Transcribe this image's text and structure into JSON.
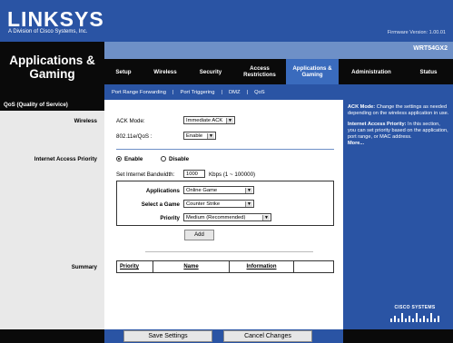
{
  "brand": {
    "logo": "LINKSYS",
    "tagline": "A Division of Cisco Systems, Inc.",
    "firmware": "Firmware Version: 1.00.01",
    "model": "WRT54GX2"
  },
  "section_title": "Applications & Gaming",
  "tabs": [
    {
      "label": "Setup",
      "active": false
    },
    {
      "label": "Wireless",
      "active": false
    },
    {
      "label": "Security",
      "active": false
    },
    {
      "label": "Access Restrictions",
      "active": false
    },
    {
      "label": "Applications & Gaming",
      "active": true
    },
    {
      "label": "Administration",
      "active": false
    },
    {
      "label": "Status",
      "active": false
    }
  ],
  "subtabs": [
    "Port Range Forwarding",
    "Port Triggering",
    "DMZ",
    "QoS"
  ],
  "left": {
    "header": "QoS (Quality of Service)",
    "wireless": "Wireless",
    "internet_priority": "Internet Access Priority",
    "summary": "Summary"
  },
  "wireless": {
    "ack_label": "ACK Mode:",
    "ack_value": "Immediate ACK",
    "wmm_label": "802.11e/QoS :",
    "wmm_value": "Enable"
  },
  "priority": {
    "enable_label": "Enable",
    "disable_label": "Disable",
    "selected": "enable",
    "bandwidth_label": "Set Internet Bandwidth:",
    "bandwidth_value": "1000",
    "bandwidth_unit": "Kbps (1 ~ 100000)",
    "applications_label": "Applications",
    "applications_value": "Online Game",
    "game_label": "Select a Game",
    "game_value": "Counter Strike",
    "priority_label": "Priority",
    "priority_value": "Medium (Recommended)",
    "add_label": "Add"
  },
  "summary_table": {
    "headers": [
      "Priority",
      "Name",
      "Information",
      ""
    ]
  },
  "help": {
    "ack_title": "ACK Mode:",
    "ack_text": " Change the settings as needed depending on the wireless application in use.",
    "iap_title": "Internet Access Priority:",
    "iap_text": " In this section, you can set priority based on the application, port range, or MAC address.",
    "more": "More..."
  },
  "cisco_logo": "CISCO SYSTEMS",
  "footer": {
    "save": "Save Settings",
    "cancel": "Cancel Changes"
  },
  "colors": {
    "brand_blue": "#2a54a4",
    "light_blue": "#6e90c7",
    "black": "#0a0a0a"
  }
}
